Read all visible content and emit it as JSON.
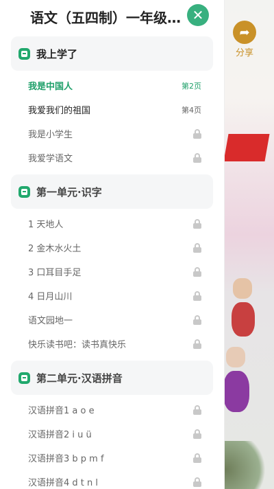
{
  "drawer": {
    "title": "语文（五四制）一年级…",
    "close_icon": "close-icon"
  },
  "share": {
    "label": "分享",
    "icon": "share-arrow-icon"
  },
  "colors": {
    "accent": "#21a86d",
    "share": "#c99128"
  },
  "sections": [
    {
      "title": "我上学了",
      "items": [
        {
          "label": "我是中国人",
          "page": "第2页",
          "state": "active"
        },
        {
          "label": "我爱我们的祖国",
          "page": "第4页",
          "state": "normal"
        },
        {
          "label": "我是小学生",
          "state": "locked"
        },
        {
          "label": "我爱学语文",
          "state": "locked"
        }
      ]
    },
    {
      "title": "第一单元·识字",
      "items": [
        {
          "label": "1 天地人",
          "state": "locked"
        },
        {
          "label": "2 金木水火土",
          "state": "locked"
        },
        {
          "label": "3 口耳目手足",
          "state": "locked"
        },
        {
          "label": "4 日月山川",
          "state": "locked"
        },
        {
          "label": "语文园地一",
          "state": "locked"
        },
        {
          "label": "快乐读书吧：读书真快乐",
          "state": "locked"
        }
      ]
    },
    {
      "title": "第二单元·汉语拼音",
      "items": [
        {
          "label": "汉语拼音1 a o e",
          "state": "locked"
        },
        {
          "label": "汉语拼音2 i u ü",
          "state": "locked"
        },
        {
          "label": "汉语拼音3 b p m f",
          "state": "locked"
        },
        {
          "label": "汉语拼音4 d t n l",
          "state": "locked"
        }
      ]
    }
  ]
}
